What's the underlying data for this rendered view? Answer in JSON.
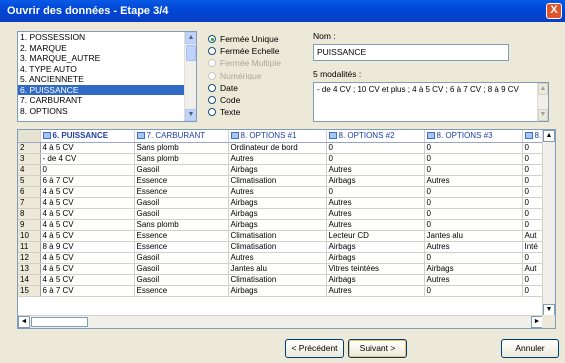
{
  "window": {
    "title": "Ouvrir des données - Etape 3/4",
    "close": "X"
  },
  "variables": {
    "items": [
      "1. POSSESSION",
      "2. MARQUE",
      "3. MARQUE_AUTRE",
      "4. TYPE AUTO",
      "5. ANCIENNETE",
      "6. PUISSANCE",
      "7. CARBURANT",
      "8. OPTIONS"
    ],
    "selected_index": 5
  },
  "types": {
    "options": [
      {
        "label": "Fermée Unique",
        "checked": true,
        "disabled": false
      },
      {
        "label": "Fermée Echelle",
        "checked": false,
        "disabled": false
      },
      {
        "label": "Fermée Multiple",
        "checked": false,
        "disabled": true
      },
      {
        "label": "Numérique",
        "checked": false,
        "disabled": true
      },
      {
        "label": "Date",
        "checked": false,
        "disabled": false
      },
      {
        "label": "Code",
        "checked": false,
        "disabled": false
      },
      {
        "label": "Texte",
        "checked": false,
        "disabled": false
      }
    ]
  },
  "name_field": {
    "label": "Nom :",
    "value": "PUISSANCE"
  },
  "modalities": {
    "label": "5 modalités :",
    "value": "- de 4 CV ; 10 CV et plus ; 4 à 5 CV ; 6 à 7 CV ; 8 à 9 CV"
  },
  "grid": {
    "headers": [
      "6. PUISSANCE",
      "7. CARBURANT",
      "8. OPTIONS #1",
      "8. OPTIONS #2",
      "8. OPTIONS #3",
      "8."
    ],
    "rows": [
      [
        "2",
        "4 à 5 CV",
        "Sans plomb",
        "Ordinateur de bord",
        "0",
        "0",
        "0"
      ],
      [
        "3",
        "- de 4 CV",
        "Sans plomb",
        "Autres",
        "0",
        "0",
        "0"
      ],
      [
        "4",
        "0",
        "Gasoil",
        "Airbags",
        "Autres",
        "0",
        "0"
      ],
      [
        "5",
        "6 à 7 CV",
        "Essence",
        "Climatisation",
        "Airbags",
        "Autres",
        "0"
      ],
      [
        "6",
        "4 à 5 CV",
        "Essence",
        "Autres",
        "0",
        "0",
        "0"
      ],
      [
        "7",
        "4 à 5 CV",
        "Gasoil",
        "Airbags",
        "Autres",
        "0",
        "0"
      ],
      [
        "8",
        "4 à 5 CV",
        "Gasoil",
        "Airbags",
        "Autres",
        "0",
        "0"
      ],
      [
        "9",
        "4 à 5 CV",
        "Sans plomb",
        "Airbags",
        "Autres",
        "0",
        "0"
      ],
      [
        "10",
        "4 à 5 CV",
        "Essence",
        "Climatisation",
        "Lecteur CD",
        "Jantes alu",
        "Aut"
      ],
      [
        "11",
        "8 à 9 CV",
        "Essence",
        "Climatisation",
        "Airbags",
        "Autres",
        "Inté"
      ],
      [
        "12",
        "4 à 5 CV",
        "Gasoil",
        "Autres",
        "Airbags",
        "0",
        "0"
      ],
      [
        "13",
        "4 à 5 CV",
        "Gasoil",
        "Jantes alu",
        "Vitres teintées",
        "Airbags",
        "Aut"
      ],
      [
        "14",
        "4 à 5 CV",
        "Gasoil",
        "Climatisation",
        "Airbags",
        "Autres",
        "0"
      ],
      [
        "15",
        "6 à 7 CV",
        "Essence",
        "Airbags",
        "Autres",
        "0",
        "0"
      ]
    ]
  },
  "buttons": {
    "prev": "< Précédent",
    "next": "Suivant >",
    "cancel": "Annuler"
  }
}
